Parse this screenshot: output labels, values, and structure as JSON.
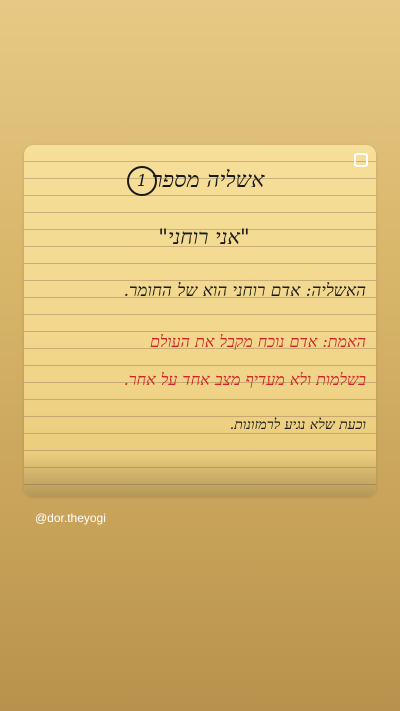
{
  "story": {
    "card": {
      "title": "אשליה מספר",
      "number": "1",
      "subtitle": "\"אני רוחני\"",
      "belief_line": "האשליה: אדם רוחני הוא של החומר.",
      "truth_line_1": "האמת: אדם נוכח מקבל את העולם",
      "truth_line_2": "בשלמות ולא מעדיף מצב אחד על אחר.",
      "closing_line": "וכעת שלא נגיע לרמזונות."
    },
    "mention_handle": "@dor.theyogi",
    "colors": {
      "background": "#d9b86c",
      "paper": "#f4d98c",
      "ink_black": "#1a1a1a",
      "ink_red": "#d0242a"
    }
  }
}
